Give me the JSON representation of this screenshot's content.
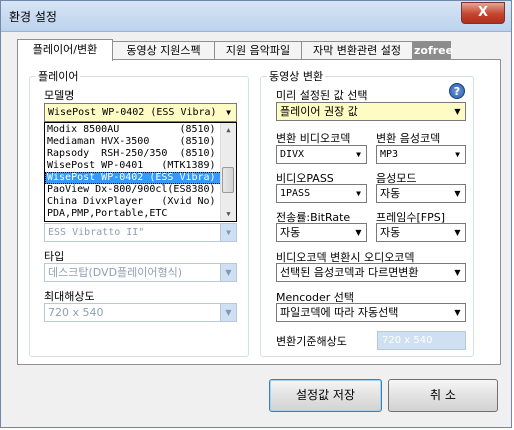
{
  "window": {
    "title": "환경 설정",
    "close_symbol": "X"
  },
  "tabs": [
    {
      "label": "플레이어/변환",
      "active": true
    },
    {
      "label": "동영상 지원스펙",
      "active": false
    },
    {
      "label": "지원 음악파일",
      "active": false
    },
    {
      "label": "자막 변환관련 설정",
      "active": false
    },
    {
      "label": "zofree",
      "active": false
    }
  ],
  "player": {
    "legend": "플레이어",
    "model_label": "모델명",
    "model_value": "WisePost WP-0402 (ESS Vibra)",
    "dropdown_items": [
      "Modix 8500AU          (8510)",
      "Mediaman HVX-3500     (8510)",
      "Rapsody  RSH-250/350  (8510)",
      "WisePost WP-0401   (MTK1389)",
      "WisePost WP-0402 (ESS Vibra)",
      "PaoView Dx-800/900cl(ES8380)",
      "China DivxPlayer   (Xvid No)",
      "PDA,PMP,Portable,ETC"
    ],
    "selected_index": 4,
    "chip_value": "ESS Vibratto II\"",
    "type_label": "타입",
    "type_value": "데스크탑(DVD플레이어형식)",
    "maxres_label": "최대해상도",
    "maxres_value": "720 x 540"
  },
  "video": {
    "legend": "동영상 변환",
    "preset_label": "미리 설정된 값 선택",
    "help_symbol": "?",
    "preset_value": "플레이어 권장 값",
    "vcodec_label": "변환 비디오코덱",
    "vcodec_value": "DIVX",
    "acodec_label": "변환 음성코덱",
    "acodec_value": "MP3",
    "vpass_label": "비디오PASS",
    "vpass_value": "1PASS",
    "amode_label": "음성모드",
    "amode_value": "자동",
    "bitrate_label": "전송률:BitRate",
    "bitrate_value": "자동",
    "fps_label": "프레임수[FPS]",
    "fps_value": "자동",
    "audio_on_convert_label": "비디오코덱 변환시 오디오코덱",
    "audio_on_convert_value": "선택된 음성코덱과 다르면변환",
    "mencoder_label": "Mencoder 선택",
    "mencoder_value": "파일코덱에 따라 자동선택",
    "base_res_label": "변환기준해상도",
    "base_res_value": "720 x 540"
  },
  "buttons": {
    "save": "설정값 저장",
    "cancel": "취 소"
  }
}
